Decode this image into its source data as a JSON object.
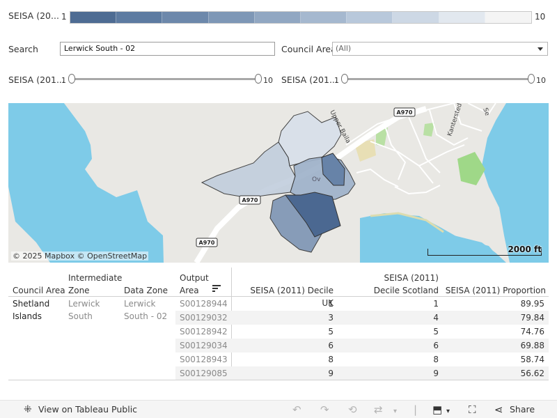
{
  "legend": {
    "label": "SEISA (20...",
    "min": "1",
    "max": "10",
    "colors": [
      "#4e6c93",
      "#5d7ba1",
      "#6d88ab",
      "#7e97b6",
      "#91a7c2",
      "#a5b8cf",
      "#b8c8db",
      "#cdd8e5",
      "#e2e8ef",
      "#f4f4f4"
    ]
  },
  "filters": {
    "search_label": "Search",
    "search_value": "Lerwick South - 02",
    "council_label": "Council Area",
    "council_value": "(All)"
  },
  "sliders": [
    {
      "label": "SEISA (201...",
      "min": "1",
      "max": "10"
    },
    {
      "label": "SEISA (201...",
      "min": "1",
      "max": "10"
    }
  ],
  "map": {
    "road_labels": [
      "A970",
      "A970",
      "A970"
    ],
    "street_labels": [
      "Upper Baila",
      "Kantersted",
      "Se"
    ],
    "place_label": "Ov",
    "attribution": "© 2025 Mapbox © OpenStreetMap",
    "scale_label": "2000 ft"
  },
  "table": {
    "headers": {
      "council_area": "Council Area",
      "intermediate_zone": "Intermediate Zone",
      "data_zone": "Data Zone",
      "output_area": "Output Area",
      "decile_uk": "SEISA (2011) Decile UK",
      "decile_scotland": "SEISA (2011) Decile Scotland",
      "proportion": "SEISA (2011) Proportion"
    },
    "group": {
      "council_area": "Shetland Islands",
      "intermediate_zone": "Lerwick South",
      "data_zone": "Lerwick South - 02"
    },
    "rows": [
      {
        "output_area": "S00128944",
        "decile_uk": "1",
        "decile_scotland": "1",
        "proportion": "89.95"
      },
      {
        "output_area": "S00129032",
        "decile_uk": "3",
        "decile_scotland": "4",
        "proportion": "79.84"
      },
      {
        "output_area": "S00128942",
        "decile_uk": "5",
        "decile_scotland": "5",
        "proportion": "74.76"
      },
      {
        "output_area": "S00129034",
        "decile_uk": "6",
        "decile_scotland": "6",
        "proportion": "69.88"
      },
      {
        "output_area": "S00128943",
        "decile_uk": "8",
        "decile_scotland": "8",
        "proportion": "58.74"
      },
      {
        "output_area": "S00129085",
        "decile_uk": "9",
        "decile_scotland": "9",
        "proportion": "56.62"
      }
    ]
  },
  "toolbar": {
    "view_label": "View on Tableau Public",
    "share_label": "Share"
  }
}
